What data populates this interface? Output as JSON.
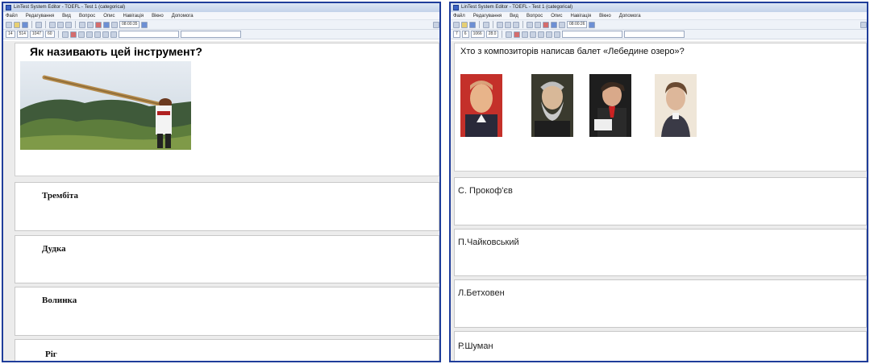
{
  "left": {
    "title": "LinTest System Editor - TOEFL - Test 1 (categorical)",
    "menu": [
      "Файл",
      "Редагування",
      "Вид",
      "Вопрос",
      "Опис",
      "Навігація",
      "Вікно",
      "Допомога"
    ],
    "toolbar_fields": [
      "14",
      "514",
      "1047",
      "60"
    ],
    "toolbar_time": "08:00:35",
    "question": "Як називають цей інструмент?",
    "answers": [
      "Трембіта",
      "Дудка",
      "Волинка",
      "Ріг"
    ]
  },
  "right": {
    "title": "LinTest System Editor - TOEFL - Test 1 (categorical)",
    "menu": [
      "Файл",
      "Редагування",
      "Вид",
      "Вопрос",
      "Опис",
      "Навігація",
      "Вікно",
      "Допомога"
    ],
    "toolbar_fields": [
      "7",
      "6",
      "1066",
      "28.0"
    ],
    "toolbar_time": "08:00:26",
    "question": "Хто з композиторів написав балет «Лебедине озеро»?",
    "answers": [
      "С. Прокоф'єв",
      "П.Чайковський",
      "Л.Бетховен",
      "Р.Шуман"
    ]
  },
  "colors": {
    "window_border": "#1f3d9a",
    "titlebar": "#c4d3ea",
    "background": "#ececec"
  },
  "icons": [
    "app-icon",
    "save-icon",
    "open-icon",
    "new-icon",
    "print-icon",
    "cut-icon",
    "copy-icon",
    "paste-icon"
  ]
}
